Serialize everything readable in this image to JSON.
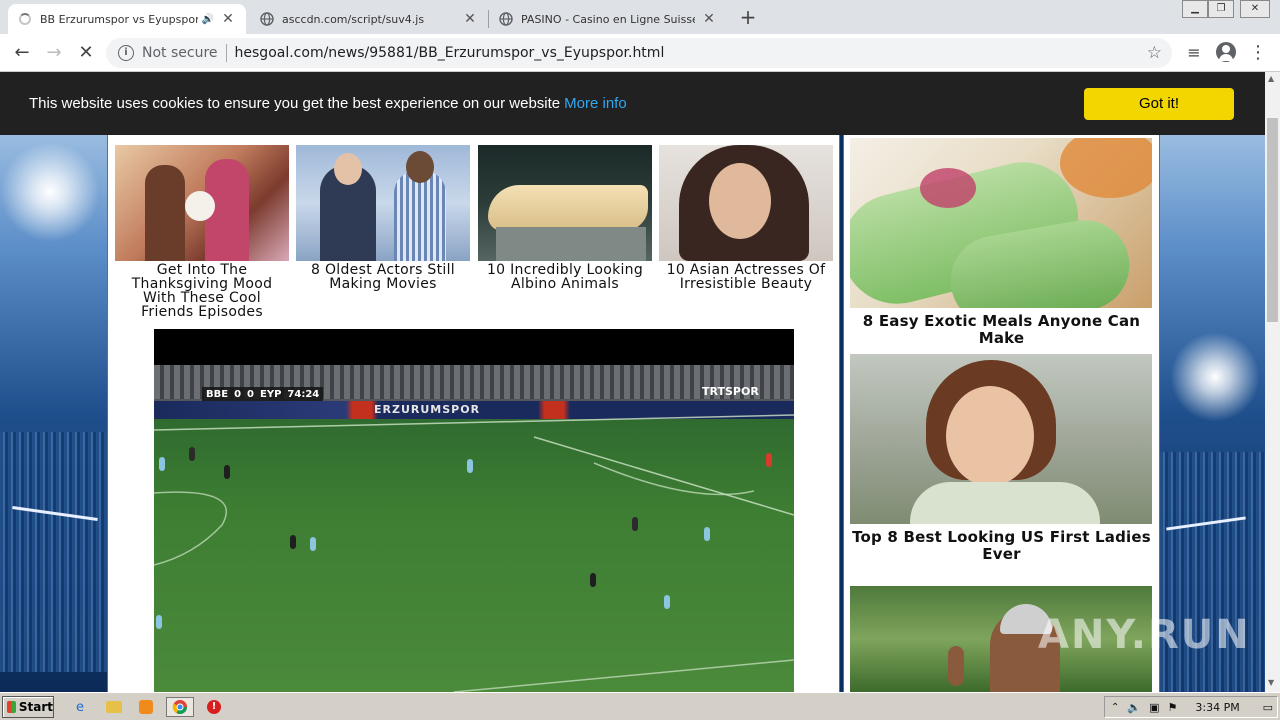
{
  "tabs": [
    {
      "title": "BB Erzurumspor vs Eyupspor - H",
      "active": true,
      "loading": true,
      "audio": true
    },
    {
      "title": "asccdn.com/script/suv4.js",
      "active": false
    },
    {
      "title": "PASINO - Casino en Ligne Suisse - Su",
      "active": false
    }
  ],
  "toolbar": {
    "security_label": "Not secure",
    "url": "hesgoal.com/news/95881/BB_Erzurumspor_vs_Eyupspor.html"
  },
  "cookie_banner": {
    "message": "This website uses cookies to ensure you get the best experience on our website",
    "more_link": "More info",
    "accept_label": "Got it!"
  },
  "ads": [
    {
      "caption_lines": [
        "Get Into The",
        "Thanksgiving Mood",
        "With These Cool",
        "Friends Episodes"
      ]
    },
    {
      "caption_lines": [
        "8 Oldest Actors Still",
        "Making Movies"
      ]
    },
    {
      "caption_lines": [
        "10 Incredibly Looking",
        "Albino Animals"
      ]
    },
    {
      "caption_lines": [
        "10 Asian Actresses Of",
        "Irresistible Beauty"
      ]
    }
  ],
  "video": {
    "scorebug": {
      "home": "BBE",
      "home_score": "0",
      "away_score": "0",
      "away": "EYP",
      "clock": "74:24"
    },
    "channel_logo": "TRTSPOR",
    "board_text": "ERZURUMSPOR"
  },
  "sidebar": [
    {
      "caption_lines": [
        "8 Easy Exotic Meals Anyone Can Make"
      ]
    },
    {
      "caption_lines": [
        "Top 8 Best Looking US First Ladies",
        "Ever"
      ]
    }
  ],
  "watermark": "ANY.RUN",
  "taskbar": {
    "start_label": "Start",
    "clock": "3:34 PM"
  },
  "colors": {
    "cookie_bg": "#212121",
    "accept_button": "#f1d600",
    "more_link": "#31a8f0",
    "frame_border": "#3a8f3a"
  }
}
